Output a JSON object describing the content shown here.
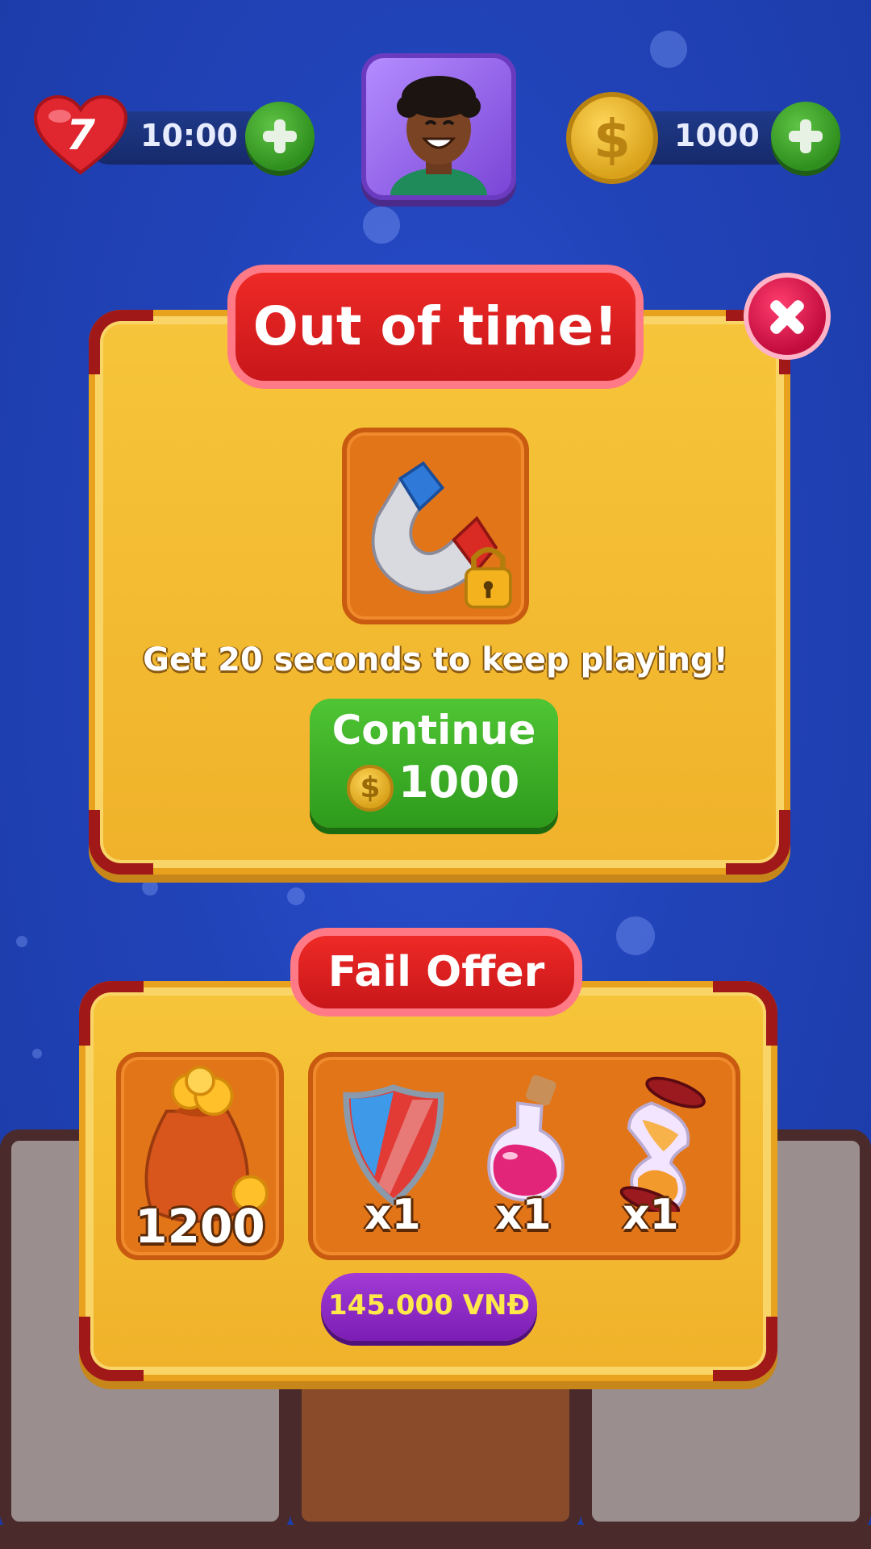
{
  "hud": {
    "lives": "7",
    "lives_timer": "10:00",
    "coins": "1000"
  },
  "out_of_time_popup": {
    "title": "Out of time!",
    "message": "Get 20 seconds to keep playing!",
    "continue_label": "Continue",
    "continue_price": "1000",
    "currency_symbol": "$",
    "booster_icon": "magnet-icon"
  },
  "fail_offer": {
    "title": "Fail Offer",
    "coin_bag_amount": "1200",
    "items": [
      {
        "icon": "shield-icon",
        "qty": "x1"
      },
      {
        "icon": "potion-icon",
        "qty": "x1"
      },
      {
        "icon": "hourglass-icon",
        "qty": "x1"
      }
    ],
    "price": "145.000 VNĐ"
  },
  "colors": {
    "background": "#2143b8",
    "panel": "#f0b22a",
    "ribbon": "#e11d22",
    "continue_button": "#3aa825",
    "price_button": "#8a27c4",
    "price_text": "#ffe94a"
  }
}
